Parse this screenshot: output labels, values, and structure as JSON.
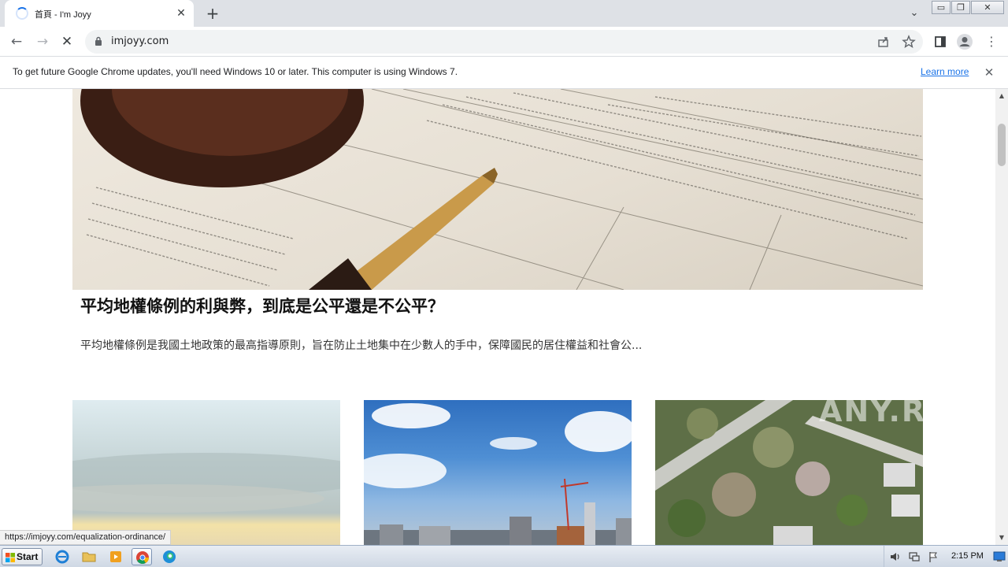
{
  "browser": {
    "tab_title": "首頁 - I'm Joyy",
    "tab_close_glyph": "✕",
    "new_tab_glyph": "+",
    "tab_menu_glyph": "⌄",
    "url": "imjoyy.com",
    "back_glyph": "←",
    "forward_glyph": "→",
    "stop_glyph": "✕",
    "menu_glyph": "⋮",
    "win_minimize_glyph": "▭",
    "win_restore_glyph": "❐",
    "win_close_glyph": "✕"
  },
  "infobar": {
    "message": "To get future Google Chrome updates, you'll need Windows 10 or later. This computer is using Windows 7.",
    "learn_more": "Learn more",
    "close_glyph": "✕"
  },
  "article": {
    "title": "平均地權條例的利與弊，到底是公平還是不公平？",
    "excerpt": "平均地權條例是我國土地政策的最高指導原則，旨在防止土地集中在少數人的手中，保障國民的居住權益和社會公..."
  },
  "status_link": "https://imjoyy.com/equalization-ordinance/",
  "watermark": "ANY.RUN",
  "taskbar": {
    "start_label": "Start",
    "clock": "2:15 PM"
  },
  "colors": {
    "accent": "#1a73e8",
    "tab_strip": "#dee1e6",
    "omnibox": "#f1f3f4"
  }
}
